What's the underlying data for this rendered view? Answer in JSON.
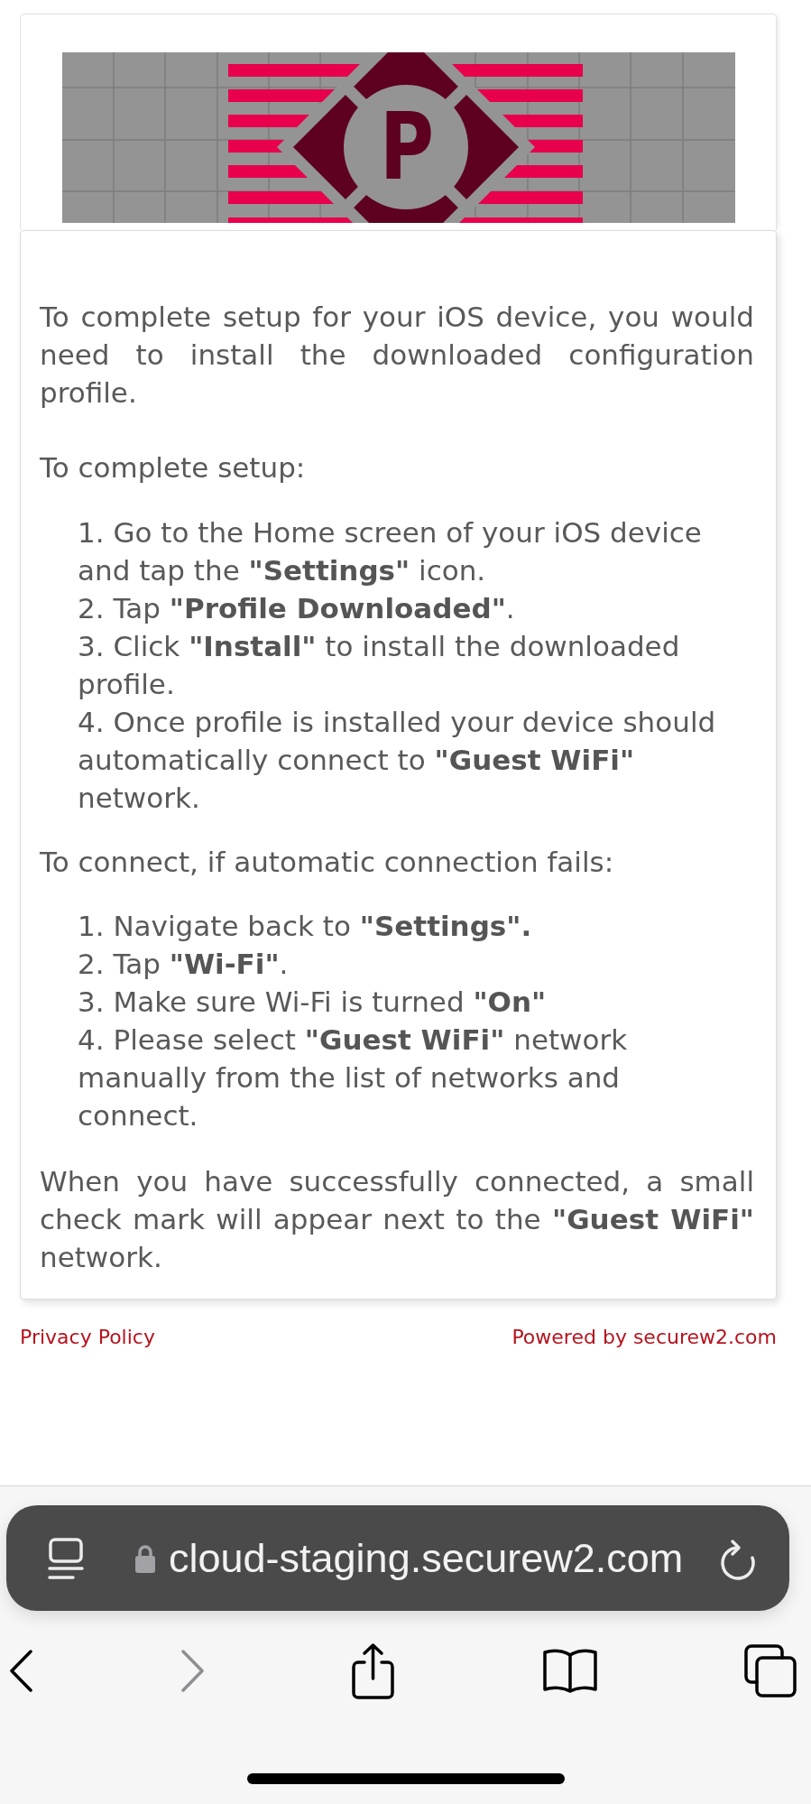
{
  "logo": {
    "letter": "P"
  },
  "instructions": {
    "intro": "To complete setup for your iOS device, you would need to install the downloaded configuration profile.",
    "sections": [
      {
        "heading": "To complete setup:",
        "steps": [
          "1. Go to the Home screen of your iOS device and tap the **\"Settings\"** icon.",
          "2. Tap **\"Profile Downloaded\"**.",
          "3. Click **\"Install\"** to install the downloaded profile.",
          "4. Once profile is installed your device should automatically connect to **\"Guest WiFi\"** network."
        ]
      },
      {
        "heading": "To connect, if automatic connection fails:",
        "steps": [
          "1. Navigate back to **\"Settings\".**",
          "2. Tap **\"Wi-Fi\"**.",
          "3. Make sure Wi-Fi is turned **\"On\"**",
          "4. Please select **\"Guest WiFi\"** network manually from the list of networks and connect."
        ]
      }
    ],
    "closing": "When you have successfully connected, a small check mark will appear next to the **\"Guest WiFi\"** network."
  },
  "footer": {
    "links": [
      "Privacy Policy",
      "Powered by securew2.com"
    ]
  },
  "address_bar": {
    "url": "cloud-staging.securew2.com"
  },
  "toolbar": [
    {
      "kind": "back",
      "disabled": false
    },
    {
      "kind": "forward",
      "disabled": true
    },
    {
      "kind": "share",
      "disabled": false
    },
    {
      "kind": "bookmarks",
      "disabled": false
    },
    {
      "kind": "tabs",
      "disabled": false
    }
  ]
}
